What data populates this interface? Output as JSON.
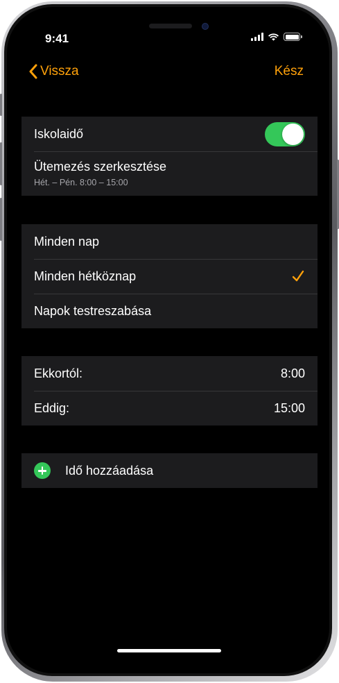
{
  "status_bar": {
    "time": "9:41",
    "icons": [
      "cellular-signal-icon",
      "wifi-icon",
      "battery-icon"
    ]
  },
  "nav": {
    "back_label": "Vissza",
    "done_label": "Kész",
    "back_icon": "chevron-left-icon"
  },
  "schedule_group": {
    "toggle_label": "Iskolaidő",
    "toggle_on": true,
    "edit_label": "Ütemezés szerkesztése",
    "edit_subtitle": "Hét. – Pén. 8:00 – 15:00"
  },
  "days_group": {
    "options": [
      {
        "label": "Minden nap",
        "selected": false
      },
      {
        "label": "Minden hétköznap",
        "selected": true
      },
      {
        "label": "Napok testreszabása",
        "selected": false
      }
    ],
    "selected_icon": "checkmark-icon"
  },
  "time_group": {
    "from_label": "Ekkortól:",
    "from_value": "8:00",
    "to_label": "Eddig:",
    "to_value": "15:00"
  },
  "add_group": {
    "add_label": "Idő hozzáadása",
    "add_icon": "plus-circle-icon"
  },
  "colors": {
    "accent": "#ffa10a",
    "toggle_on": "#34c759",
    "background": "#000000",
    "cell": "#1c1c1e",
    "separator": "#38383a"
  }
}
